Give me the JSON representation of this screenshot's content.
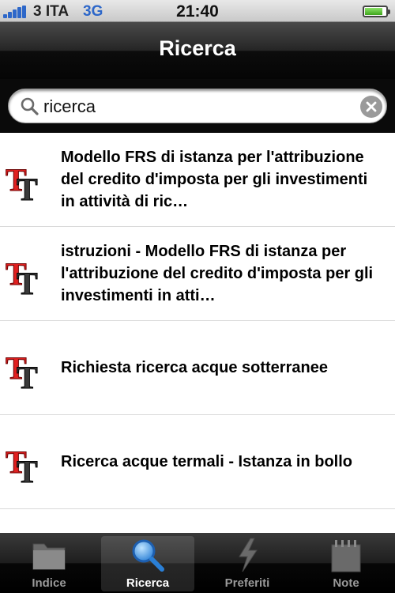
{
  "status_bar": {
    "carrier": "3 ITA",
    "network": "3G",
    "time": "21:40"
  },
  "nav": {
    "title": "Ricerca"
  },
  "search": {
    "value": "ricerca",
    "placeholder": ""
  },
  "results": [
    {
      "title": "Modello FRS di istanza per l'attribuzione del credito d'imposta per gli investimenti in attività di ric…",
      "icon": "tt-document-icon"
    },
    {
      "title": "istruzioni - Modello FRS di istanza per l'attribuzione del credito d'imposta per gli investimenti in atti…",
      "icon": "tt-document-icon"
    },
    {
      "title": "Richiesta ricerca acque sotterranee",
      "icon": "tt-document-icon"
    },
    {
      "title": "Ricerca acque termali - Istanza in bollo",
      "icon": "tt-document-icon"
    }
  ],
  "tabs": [
    {
      "label": "Indice",
      "icon": "folder-icon",
      "active": false
    },
    {
      "label": "Ricerca",
      "icon": "magnifier-icon",
      "active": true
    },
    {
      "label": "Preferiti",
      "icon": "lightning-icon",
      "active": false
    },
    {
      "label": "Note",
      "icon": "notepad-icon",
      "active": false
    }
  ],
  "colors": {
    "accent_blue": "#2d67c9",
    "icon_red": "#e02020",
    "icon_dark": "#333333"
  }
}
